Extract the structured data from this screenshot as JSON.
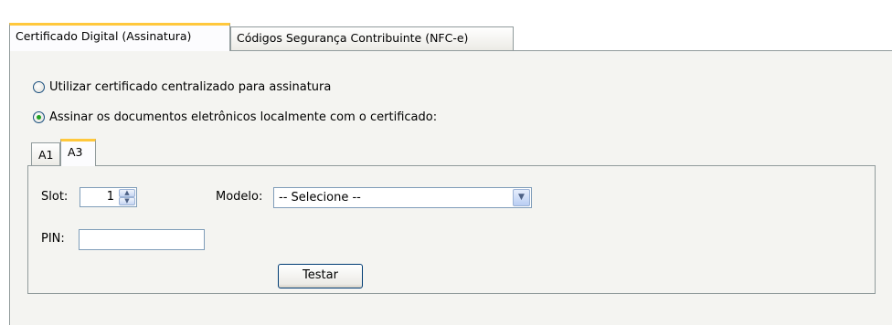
{
  "outer_tabs": [
    {
      "label": "Certificado Digital (Assinatura)",
      "active": true
    },
    {
      "label": "Códigos Segurança Contribuinte (NFC-e)",
      "active": false
    }
  ],
  "options": {
    "centralized": {
      "label": "Utilizar certificado centralizado para assinatura",
      "selected": false
    },
    "local": {
      "label": "Assinar os documentos eletrônicos localmente com o certificado:",
      "selected": true
    }
  },
  "inner_tabs": [
    {
      "label": "A1",
      "active": false
    },
    {
      "label": "A3",
      "active": true
    }
  ],
  "form": {
    "slot_label": "Slot:",
    "slot_value": "1",
    "modelo_label": "Modelo:",
    "modelo_value": "-- Selecione --",
    "pin_label": "PIN:",
    "pin_value": "",
    "test_button": "Testar"
  },
  "colors": {
    "tab_highlight": "#ffc83c",
    "panel_bg": "#f4f4f1",
    "radio_dot": "#21a121",
    "button_border": "#003c74"
  }
}
